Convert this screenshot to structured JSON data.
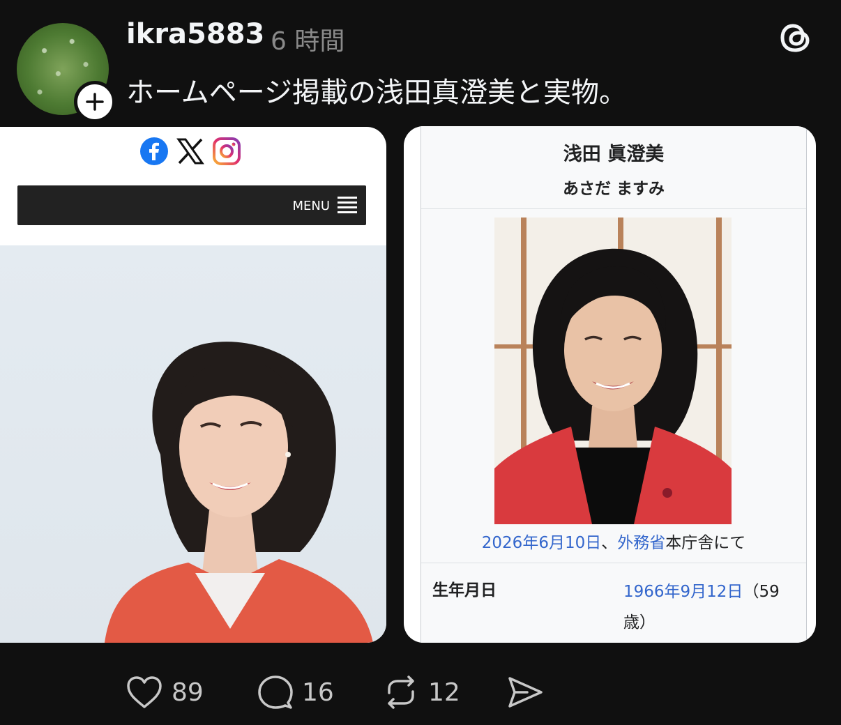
{
  "post": {
    "username": "ikra5883",
    "timestamp": "6 時間",
    "caption": "ホームページ掲載の浅田真澄美と実物。",
    "icons": {
      "follow": "plus-icon",
      "app_logo": "threads-logo-icon"
    }
  },
  "left_image": {
    "menu_label": "MENU",
    "social_icons": [
      "facebook-icon",
      "x-icon",
      "instagram-icon"
    ]
  },
  "right_image": {
    "name": "浅田 眞澄美",
    "kana": "あさだ ますみ",
    "photo_caption": {
      "date": "2026年6月10日",
      "sep": "、",
      "place": "外務省",
      "rest": "本庁舎にて"
    },
    "row": {
      "label": "生年月日",
      "date": "1966年9月12日",
      "age_open": "（59",
      "age_close": "歳）"
    }
  },
  "actions": {
    "likes": "89",
    "replies": "16",
    "reposts": "12"
  },
  "colors": {
    "background": "#101010",
    "link": "#3366cc",
    "jacket": "#d93a3e"
  }
}
